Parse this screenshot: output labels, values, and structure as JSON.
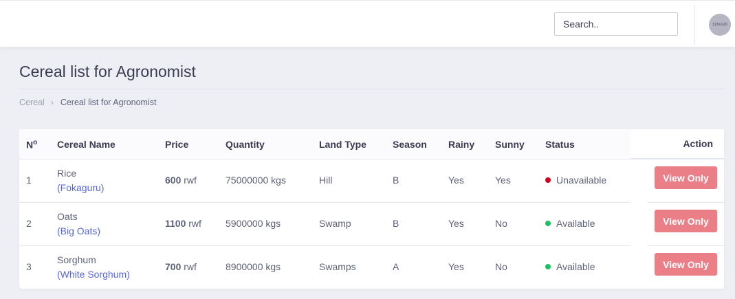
{
  "topbar": {
    "search_placeholder": "Search..",
    "avatar_text": "120x120"
  },
  "page": {
    "title": "Cereal list for Agronomist"
  },
  "breadcrumb": {
    "items": [
      "Cereal",
      "Cereal list for Agronomist"
    ],
    "separator": "›"
  },
  "table": {
    "headers": {
      "no": "N",
      "no_sup": "o",
      "name": "Cereal Name",
      "price": "Price",
      "quantity": "Quantity",
      "land_type": "Land Type",
      "season": "Season",
      "rainy": "Rainy",
      "sunny": "Sunny",
      "status": "Status",
      "action": "Action"
    },
    "rows": [
      {
        "no": "1",
        "name": "Rice",
        "variety": "(Fokaguru)",
        "price": "600",
        "price_unit": " rwf",
        "quantity": "75000000 kgs",
        "land_type": "Hill",
        "season": "B",
        "rainy": "Yes",
        "sunny": "Yes",
        "status": "Unavailable",
        "status_color": "#d0021b",
        "action": "View Only"
      },
      {
        "no": "2",
        "name": "Oats",
        "variety": "(Big Oats)",
        "price": "1100",
        "price_unit": " rwf",
        "quantity": "5900000 kgs",
        "land_type": "Swamp",
        "season": "B",
        "rainy": "Yes",
        "sunny": "No",
        "status": "Available",
        "status_color": "#1bc35f",
        "action": "View Only"
      },
      {
        "no": "3",
        "name": "Sorghum",
        "variety": "(White Sorghum)",
        "price": "700",
        "price_unit": " rwf",
        "quantity": "8900000 kgs",
        "land_type": "Swamps",
        "season": "A",
        "rainy": "Yes",
        "sunny": "No",
        "status": "Available",
        "status_color": "#1bc35f",
        "action": "View Only"
      }
    ]
  }
}
